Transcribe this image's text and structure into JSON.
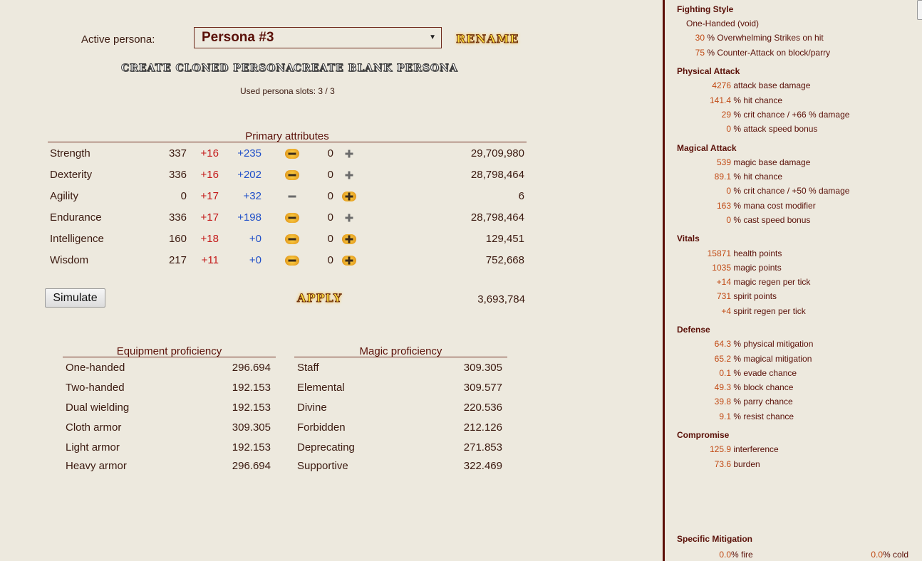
{
  "persona": {
    "label": "Active persona:",
    "selected": "Persona #3",
    "rename_label": "RENAME",
    "create_cloned_label": "CREATE CLONED PERSONA",
    "create_blank_label": "CREATE BLANK PERSONA",
    "slots_text": "Used persona slots: 3 / 3"
  },
  "attributes": {
    "title": "Primary attributes",
    "rows": [
      {
        "name": "Strength",
        "base": "337",
        "red": "+16",
        "blue": "+235",
        "zero": "0",
        "total": "29,709,980",
        "plus_active": false
      },
      {
        "name": "Dexterity",
        "base": "336",
        "red": "+16",
        "blue": "+202",
        "zero": "0",
        "total": "28,798,464",
        "plus_active": false
      },
      {
        "name": "Agility",
        "base": "0",
        "red": "+17",
        "blue": "+32",
        "zero": "0",
        "total": "6",
        "plus_active": true
      },
      {
        "name": "Endurance",
        "base": "336",
        "red": "+17",
        "blue": "+198",
        "zero": "0",
        "total": "28,798,464",
        "plus_active": false
      },
      {
        "name": "Intelligence",
        "base": "160",
        "red": "+18",
        "blue": "+0",
        "zero": "0",
        "total": "129,451",
        "plus_active": true
      },
      {
        "name": "Wisdom",
        "base": "217",
        "red": "+11",
        "blue": "+0",
        "zero": "0",
        "total": "752,668",
        "plus_active": true
      }
    ],
    "simulate_label": "Simulate",
    "apply_label": "APPLY",
    "remaining": "3,693,784"
  },
  "equipment": {
    "title": "Equipment proficiency",
    "rows": [
      {
        "name": "One-handed",
        "value": "296.694"
      },
      {
        "name": "Two-handed",
        "value": "192.153"
      },
      {
        "name": "Dual wielding",
        "value": "192.153"
      },
      {
        "name": "Cloth armor",
        "value": "309.305"
      },
      {
        "name": "Light armor",
        "value": "192.153"
      },
      {
        "name": "Heavy armor",
        "value": "296.694"
      }
    ]
  },
  "magic": {
    "title": "Magic proficiency",
    "rows": [
      {
        "name": "Staff",
        "value": "309.305"
      },
      {
        "name": "Elemental",
        "value": "309.577"
      },
      {
        "name": "Divine",
        "value": "220.536"
      },
      {
        "name": "Forbidden",
        "value": "212.126"
      },
      {
        "name": "Deprecating",
        "value": "271.853"
      },
      {
        "name": "Supportive",
        "value": "322.469"
      }
    ]
  },
  "stats": {
    "fighting_style": {
      "title": "Fighting Style",
      "style": "One-Handed (void)",
      "lines": [
        {
          "num": "30",
          "text": " % Overwhelming Strikes on hit"
        },
        {
          "num": "75",
          "text": " % Counter-Attack on block/parry"
        }
      ]
    },
    "physical_attack": {
      "title": "Physical Attack",
      "lines": [
        {
          "num": "4276",
          "text": " attack base damage"
        },
        {
          "num": "141.4",
          "text": " % hit chance"
        },
        {
          "num": "29",
          "text": " % crit chance / +66 % damage"
        },
        {
          "num": "0",
          "text": " % attack speed bonus"
        }
      ]
    },
    "magical_attack": {
      "title": "Magical Attack",
      "lines": [
        {
          "num": "539",
          "text": " magic base damage"
        },
        {
          "num": "89.1",
          "text": " % hit chance"
        },
        {
          "num": "0",
          "text": " % crit chance / +50 % damage"
        },
        {
          "num": "163",
          "text": " % mana cost modifier"
        },
        {
          "num": "0",
          "text": " % cast speed bonus"
        }
      ]
    },
    "vitals": {
      "title": "Vitals",
      "lines": [
        {
          "num": "15871",
          "text": " health points"
        },
        {
          "num": "1035",
          "text": " magic points"
        },
        {
          "num": "+14",
          "text": " magic regen per tick"
        },
        {
          "num": "731",
          "text": " spirit points"
        },
        {
          "num": "+4",
          "text": " spirit regen per tick"
        }
      ]
    },
    "defense": {
      "title": "Defense",
      "lines": [
        {
          "num": "64.3",
          "text": " % physical mitigation"
        },
        {
          "num": "65.2",
          "text": " % magical mitigation"
        },
        {
          "num": "0.1",
          "text": " % evade chance"
        },
        {
          "num": "49.3",
          "text": " % block chance"
        },
        {
          "num": "39.8",
          "text": " % parry chance"
        },
        {
          "num": "9.1",
          "text": " % resist chance"
        }
      ]
    },
    "compromise": {
      "title": "Compromise",
      "lines": [
        {
          "num": "125.9",
          "text": " interference"
        },
        {
          "num": "73.6",
          "text": " burden"
        }
      ]
    },
    "specific_mitigation": {
      "title": "Specific Mitigation",
      "fire_num": "0.0",
      "fire_text": "% fire",
      "cold_num": "0.0",
      "cold_text": "% cold"
    }
  },
  "colors": {
    "background": "#ede9de",
    "accent_dark_red": "#5c0f08",
    "number_orange": "#c14a14",
    "bonus_red": "#c41a1a",
    "bonus_blue": "#1f4fc8"
  }
}
